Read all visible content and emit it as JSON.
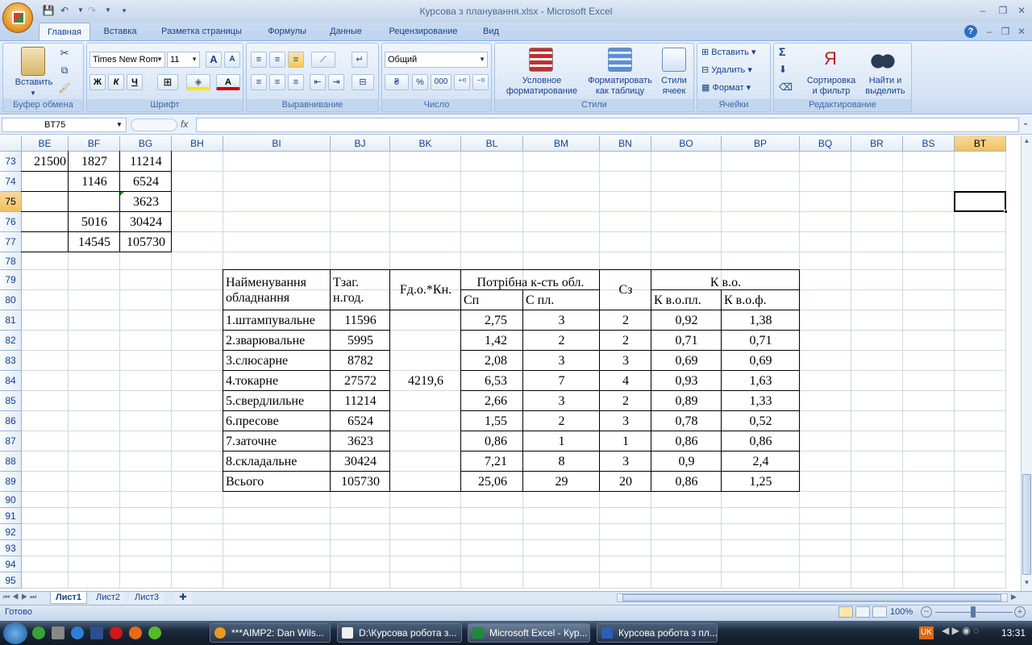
{
  "app": {
    "title": "Курсова з планування.xlsx - Microsoft Excel"
  },
  "tabs": [
    "Главная",
    "Вставка",
    "Разметка страницы",
    "Формулы",
    "Данные",
    "Рецензирование",
    "Вид"
  ],
  "ribbon": {
    "clipboard": {
      "paste": "Вставить",
      "label": "Буфер обмена"
    },
    "font": {
      "name": "Times New Rom",
      "size": "11",
      "bold": "Ж",
      "italic": "К",
      "underline": "Ч",
      "grow": "A",
      "shrink": "A",
      "color": "A",
      "label": "Шрифт"
    },
    "alignment": {
      "label": "Выравнивание"
    },
    "number": {
      "format": "Общий",
      "percent": "%",
      "thousands": "000",
      "label": "Число"
    },
    "styles": {
      "conditional": "Условное",
      "conditional2": "форматирование",
      "table": "Форматировать",
      "table2": "как таблицу",
      "cell": "Стили",
      "cell2": "ячеек",
      "label": "Стили"
    },
    "cells": {
      "insert": "Вставить",
      "delete": "Удалить",
      "format": "Формат",
      "label": "Ячейки"
    },
    "editing": {
      "sigma": "Σ",
      "sort": "Сортировка",
      "sort2": "и фильтр",
      "find": "Найти и",
      "find2": "выделить",
      "label": "Редактирование"
    }
  },
  "formula": {
    "namebox": "BT75",
    "fx": "fx",
    "value": ""
  },
  "columns": [
    "BE",
    "BF",
    "BG",
    "BH",
    "BI",
    "BJ",
    "BK",
    "BL",
    "BM",
    "BN",
    "BO",
    "BP",
    "BQ",
    "BR",
    "BS",
    "BT"
  ],
  "rows": [
    "73",
    "74",
    "75",
    "76",
    "77",
    "78",
    "79",
    "80",
    "81",
    "82",
    "83",
    "84",
    "85",
    "86",
    "87",
    "88",
    "89",
    "90",
    "91",
    "92",
    "93",
    "94",
    "95"
  ],
  "left_table": [
    [
      "21500",
      "1827",
      "11214"
    ],
    [
      "",
      "1146",
      "6524"
    ],
    [
      "",
      "",
      "3623"
    ],
    [
      "",
      "5016",
      "30424"
    ],
    [
      "",
      "14545",
      "105730"
    ]
  ],
  "table": {
    "h_name": "Найменування обладнання",
    "h_tzag": "Тзаг. н.год.",
    "h_fd": "Fд.о.*Кн.",
    "h_potr": "Потрібна к-сть обл.",
    "h_cp": "Сп",
    "h_cpl": "С пл.",
    "h_cz": "Сз",
    "h_kvo": "К в.о.",
    "h_kvopl": "К в.о.пл.",
    "h_kvof": "К в.о.ф.",
    "fd_value": "4219,6",
    "rows": [
      [
        "1.штампувальне",
        "11596",
        "2,75",
        "3",
        "2",
        "0,92",
        "1,38"
      ],
      [
        "2.зварювальне",
        "5995",
        "1,42",
        "2",
        "2",
        "0,71",
        "0,71"
      ],
      [
        "3.слюсарне",
        "8782",
        "2,08",
        "3",
        "3",
        "0,69",
        "0,69"
      ],
      [
        "4.токарне",
        "27572",
        "6,53",
        "7",
        "4",
        "0,93",
        "1,63"
      ],
      [
        "5.свердлильне",
        "11214",
        "2,66",
        "3",
        "2",
        "0,89",
        "1,33"
      ],
      [
        "6.пресове",
        "6524",
        "1,55",
        "2",
        "3",
        "0,78",
        "0,52"
      ],
      [
        "7.заточне",
        "3623",
        "0,86",
        "1",
        "1",
        "0,86",
        "0,86"
      ],
      [
        "8.складальне",
        "30424",
        "7,21",
        "8",
        "3",
        "0,9",
        "2,4"
      ],
      [
        "Всього",
        "105730",
        "25,06",
        "29",
        "20",
        "0,86",
        "1,25"
      ]
    ]
  },
  "sheets": [
    "Лист1",
    "Лист2",
    "Лист3"
  ],
  "status": {
    "ready": "Готово",
    "zoom": "100%"
  },
  "taskbar": {
    "items": [
      "***AIMP2: Dan Wils...",
      "D:\\Курсова робота з...",
      "Microsoft Excel - Кур...",
      "Курсова робота з пл..."
    ],
    "lang": "UK",
    "time": "13:31"
  }
}
